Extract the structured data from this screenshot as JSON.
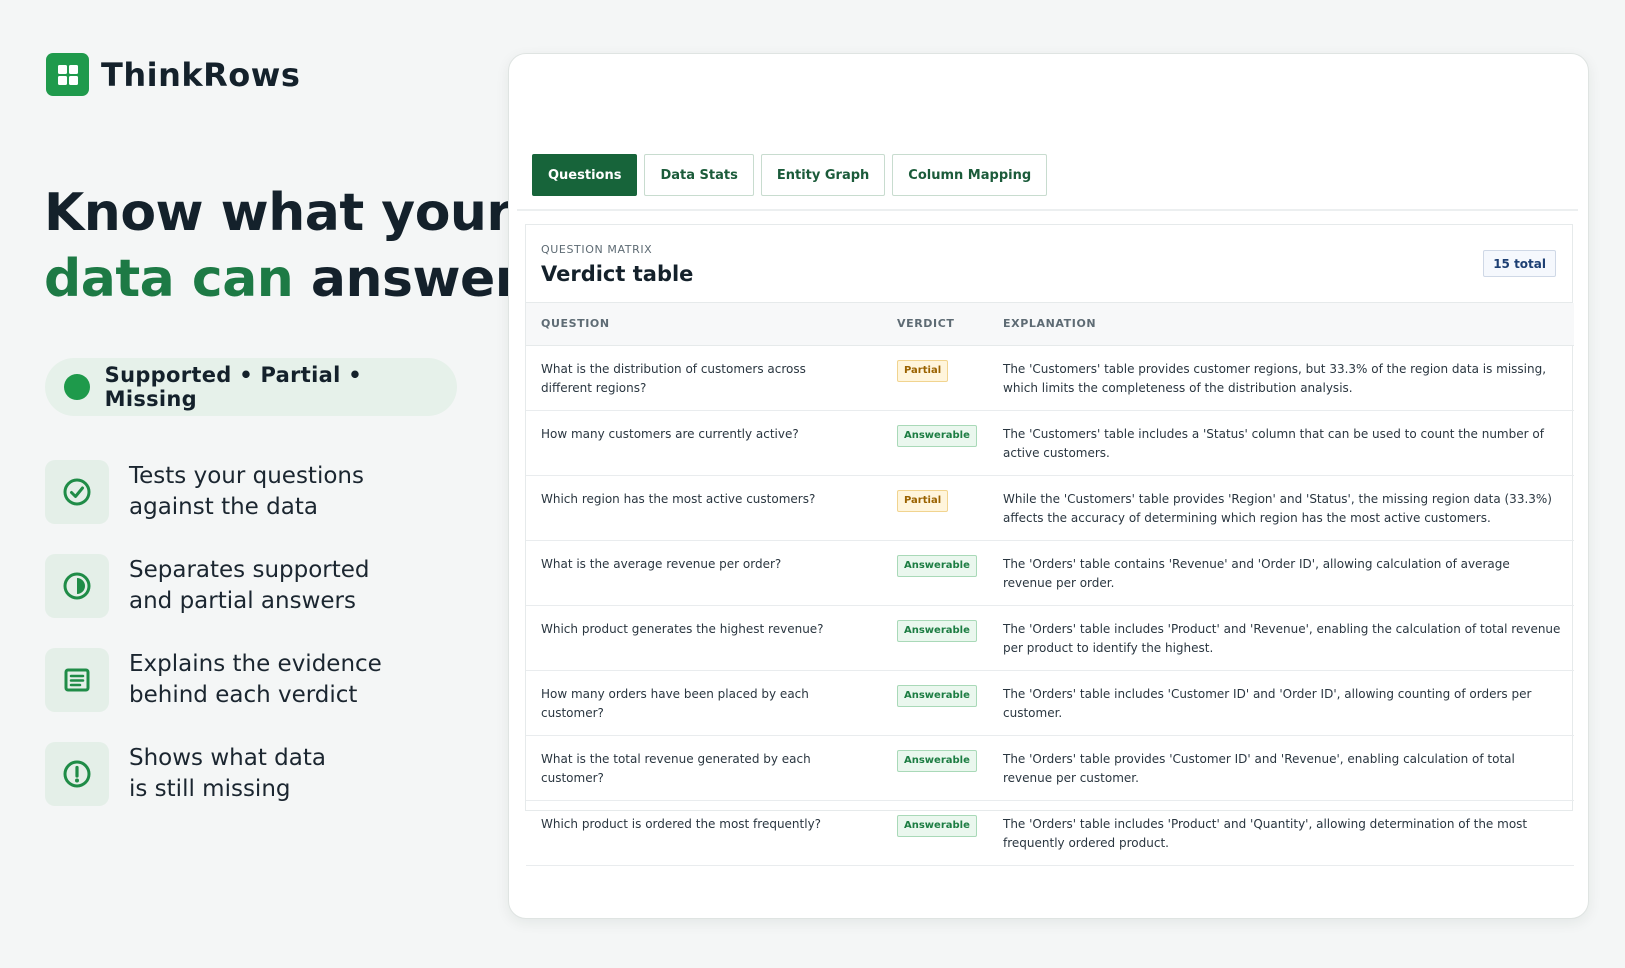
{
  "brand": {
    "name": "ThinkRows",
    "logo_icon": "grid-icon",
    "color": "#1f9a4c"
  },
  "hero": {
    "headline_line1": "Know what your",
    "headline_accent": "data can",
    "headline_rest": "answer",
    "accent_color": "#1d7a45",
    "pill_text": "Supported • Partial • Missing"
  },
  "features": [
    {
      "icon": "check-circle-icon",
      "text": "Tests your questions\nagainst the data"
    },
    {
      "icon": "half-circle-icon",
      "text": "Separates supported\nand partial answers"
    },
    {
      "icon": "document-lines-icon",
      "text": "Explains the evidence\nbehind each verdict"
    },
    {
      "icon": "exclamation-circle-icon",
      "text": "Shows what data\nis still missing"
    }
  ],
  "tabs": [
    {
      "label": "Questions",
      "active": true
    },
    {
      "label": "Data Stats",
      "active": false
    },
    {
      "label": "Entity Graph",
      "active": false
    },
    {
      "label": "Column Mapping",
      "active": false
    }
  ],
  "panel": {
    "kicker": "QUESTION MATRIX",
    "title": "Verdict table",
    "total": "15 total"
  },
  "table": {
    "headers": {
      "question": "QUESTION",
      "verdict": "VERDICT",
      "explanation": "EXPLANATION"
    },
    "rows": [
      {
        "question": "What is the distribution of customers across different regions?",
        "verdict": "Partial",
        "explanation": "The 'Customers' table provides customer regions, but 33.3% of the region data is missing, which limits the completeness of the distribution analysis."
      },
      {
        "question": "How many customers are currently active?",
        "verdict": "Answerable",
        "explanation": "The 'Customers' table includes a 'Status' column that can be used to count the number of active customers."
      },
      {
        "question": "Which region has the most active customers?",
        "verdict": "Partial",
        "explanation": "While the 'Customers' table provides 'Region' and 'Status', the missing region data (33.3%) affects the accuracy of determining which region has the most active customers."
      },
      {
        "question": "What is the average revenue per order?",
        "verdict": "Answerable",
        "explanation": "The 'Orders' table contains 'Revenue' and 'Order ID', allowing calculation of average revenue per order."
      },
      {
        "question": "Which product generates the highest revenue?",
        "verdict": "Answerable",
        "explanation": "The 'Orders' table includes 'Product' and 'Revenue', enabling the calculation of total revenue per product to identify the highest."
      },
      {
        "question": "How many orders have been placed by each customer?",
        "verdict": "Answerable",
        "explanation": "The 'Orders' table includes 'Customer ID' and 'Order ID', allowing counting of orders per customer."
      },
      {
        "question": "What is the total revenue generated by each customer?",
        "verdict": "Answerable",
        "explanation": "The 'Orders' table provides 'Customer ID' and 'Revenue', enabling calculation of total revenue per customer."
      },
      {
        "question": "Which product is ordered the most frequently?",
        "verdict": "Answerable",
        "explanation": "The 'Orders' table includes 'Product' and 'Quantity', allowing determination of the most frequently ordered product."
      }
    ]
  }
}
